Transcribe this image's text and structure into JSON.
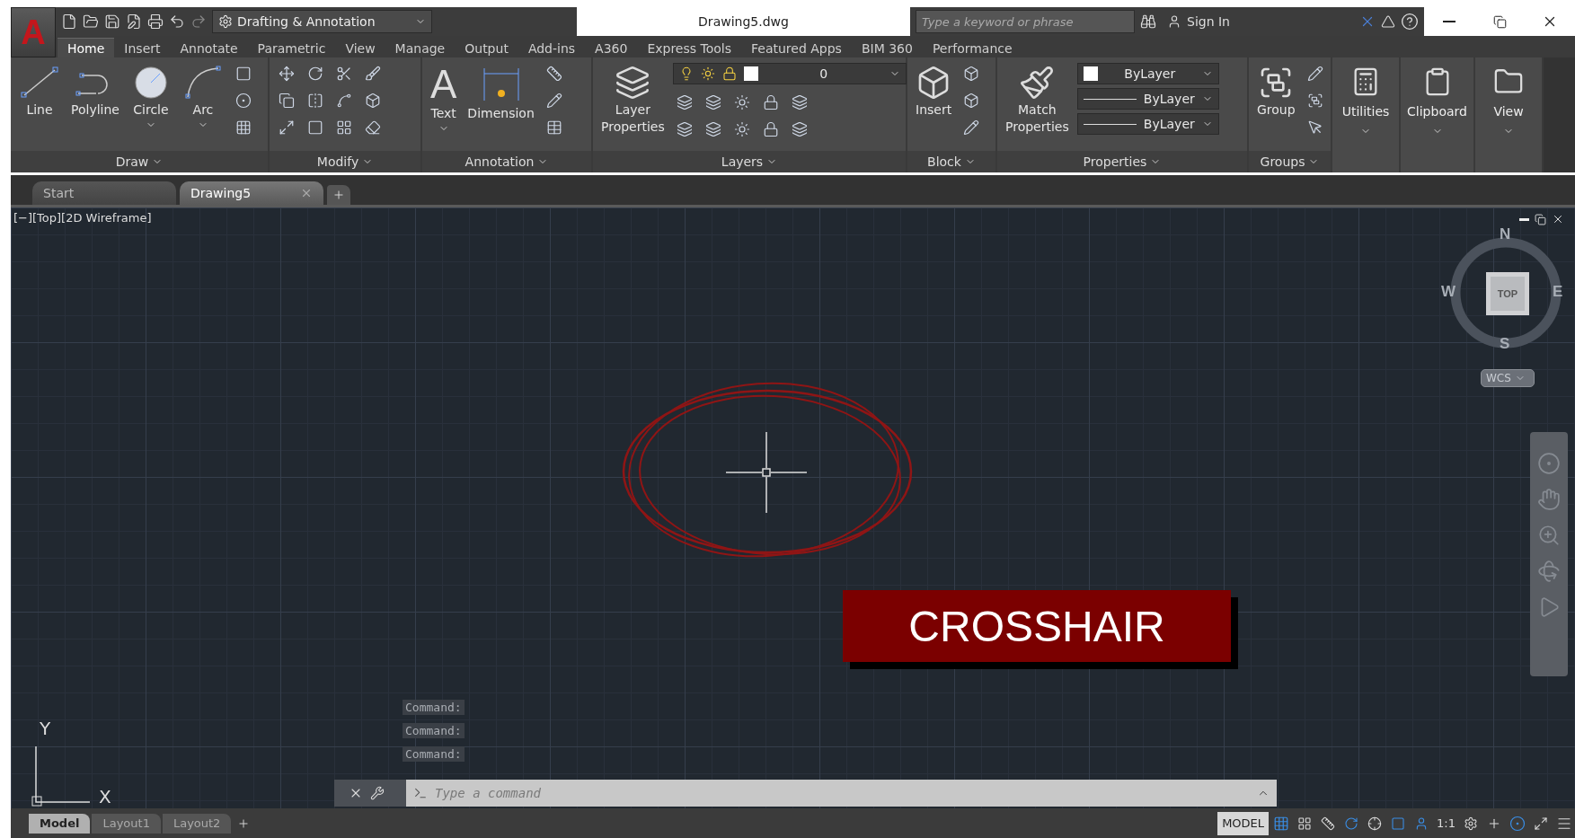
{
  "app_menu": {
    "logo": "A"
  },
  "workspace": "Drafting & Annotation",
  "title": "Drawing5.dwg",
  "search": {
    "placeholder": "Type a keyword or phrase"
  },
  "sign_in": "Sign In",
  "ribbon_tabs": [
    {
      "label": "Home",
      "selected": true
    },
    {
      "label": "Insert",
      "selected": false
    },
    {
      "label": "Annotate",
      "selected": false
    },
    {
      "label": "Parametric",
      "selected": false
    },
    {
      "label": "View",
      "selected": false
    },
    {
      "label": "Manage",
      "selected": false
    },
    {
      "label": "Output",
      "selected": false
    },
    {
      "label": "Add-ins",
      "selected": false
    },
    {
      "label": "A360",
      "selected": false
    },
    {
      "label": "Express Tools",
      "selected": false
    },
    {
      "label": "Featured Apps",
      "selected": false
    },
    {
      "label": "BIM 360",
      "selected": false
    },
    {
      "label": "Performance",
      "selected": false
    }
  ],
  "panels": [
    {
      "kind": "draw",
      "title": "Draw",
      "buttons": [
        {
          "label": "Line",
          "has_menu": false
        },
        {
          "label": "Polyline",
          "has_menu": false
        },
        {
          "label": "Circle",
          "has_menu": true
        },
        {
          "label": "Arc",
          "has_menu": true
        }
      ]
    },
    {
      "kind": "modify",
      "title": "Modify"
    },
    {
      "kind": "annotation",
      "title": "Annotation",
      "glyph": "A",
      "buttons": [
        {
          "label": "Text",
          "has_menu": true
        },
        {
          "label": "Dimension",
          "has_menu": false
        }
      ]
    },
    {
      "kind": "layers",
      "title": "Layers",
      "layer": "0",
      "buttons": [
        {
          "label": "Layer Properties",
          "has_menu": false
        }
      ]
    },
    {
      "kind": "block",
      "title": "Block",
      "buttons": [
        {
          "label": "Insert",
          "has_menu": false
        }
      ]
    },
    {
      "kind": "properties",
      "title": "Properties",
      "dropdowns": [
        "ByLayer",
        "ByLayer",
        "ByLayer"
      ],
      "buttons": [
        {
          "label": "Match Properties",
          "has_menu": false
        }
      ]
    },
    {
      "kind": "groups",
      "title": "Groups",
      "buttons": [
        {
          "label": "Group",
          "has_menu": false
        }
      ]
    },
    {
      "kind": "collapsed",
      "title": "Utilities"
    },
    {
      "kind": "collapsed",
      "title": "Clipboard"
    },
    {
      "kind": "collapsed",
      "title": "View"
    }
  ],
  "file_tabs": [
    {
      "label": "Start",
      "selected": false
    },
    {
      "label": "Drawing5",
      "selected": true
    }
  ],
  "viewport": {
    "label": "[−][Top][2D Wireframe]",
    "viewcube": {
      "north": "N",
      "south": "S",
      "east": "E",
      "west": "W",
      "face": "TOP",
      "ucs": "WCS"
    },
    "ucs_axes": {
      "x": "X",
      "y": "Y"
    },
    "callout": "CROSSHAIR",
    "command_history": [
      "Command:",
      "Command:",
      "Command:"
    ],
    "command_placeholder": "Type a command"
  },
  "layout_tabs": [
    {
      "label": "Model",
      "selected": true
    },
    {
      "label": "Layout1",
      "selected": false
    },
    {
      "label": "Layout2",
      "selected": false
    }
  ],
  "status": {
    "space": "MODEL",
    "scale": "1:1"
  }
}
